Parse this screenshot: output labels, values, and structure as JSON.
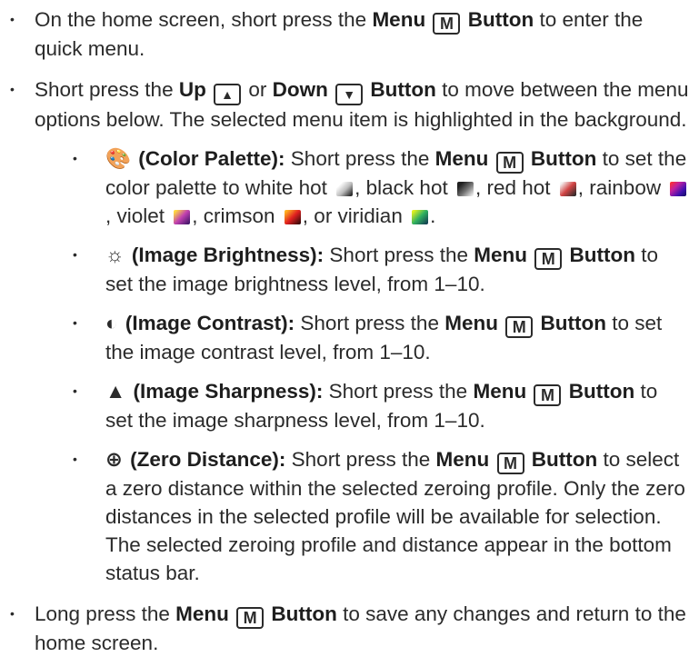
{
  "bullets": {
    "b1": {
      "p1": "On the home screen, short press the ",
      "menu": "Menu",
      "m": "M",
      "button": "Button",
      "p2": " to enter the quick menu."
    },
    "b2": {
      "p1": "Short press the ",
      "up": "Up",
      "up_key": "▲",
      "or": " or ",
      "down": "Down",
      "down_key": "▼",
      "button": "Button",
      "p2": " to move between the menu options below. The selected menu item is highlighted in the background."
    },
    "b3": {
      "p1": "Long press the ",
      "menu": "Menu",
      "m": "M",
      "button": "Button",
      "p2": " to save any changes and return to the home screen."
    }
  },
  "menu_items": {
    "palette": {
      "icon": "palette-icon",
      "symbol": "🎨",
      "label": "(Color Palette):",
      "p1": "  Short press the ",
      "menu": "Menu",
      "m": "M",
      "button": "Button",
      "p2": " to set the color palette to white hot ",
      "p3": ", black hot ",
      "p4": ", red hot ",
      "p5": ", rainbow ",
      "p6": ", violet ",
      "p7": ", crimson ",
      "p8": ", or viridian ",
      "p9": "."
    },
    "brightness": {
      "icon": "brightness-icon",
      "symbol": "☼",
      "label": "(Image Brightness):",
      "p1": "  Short press the ",
      "menu": "Menu",
      "m": "M",
      "button": "Button",
      "p2": " to set the image brightness level, from 1–10."
    },
    "contrast": {
      "icon": "contrast-icon",
      "symbol": "◐",
      "label": "(Image Contrast):",
      "p1": "  Short press the ",
      "menu": "Menu",
      "m": "M",
      "button": "Button",
      "p2": " to set the image contrast level, from 1–10."
    },
    "sharpness": {
      "icon": "sharpness-icon",
      "symbol": "▲",
      "label": "(Image Sharpness):",
      "p1": "  Short press the ",
      "menu": "Menu",
      "m": "M",
      "button": "Button",
      "p2": " to set the image sharpness level, from 1–10."
    },
    "zero": {
      "icon": "crosshair-icon",
      "symbol": "⊕",
      "label": "(Zero Distance):",
      "p1": "  Short press the ",
      "menu": "Menu",
      "m": "M",
      "button": "Button",
      "p2": " to select a zero distance within the selected zeroing profile. Only the zero distances in the selected profile will be available for selection. The selected zeroing profile and distance appear in the bottom status bar."
    }
  }
}
